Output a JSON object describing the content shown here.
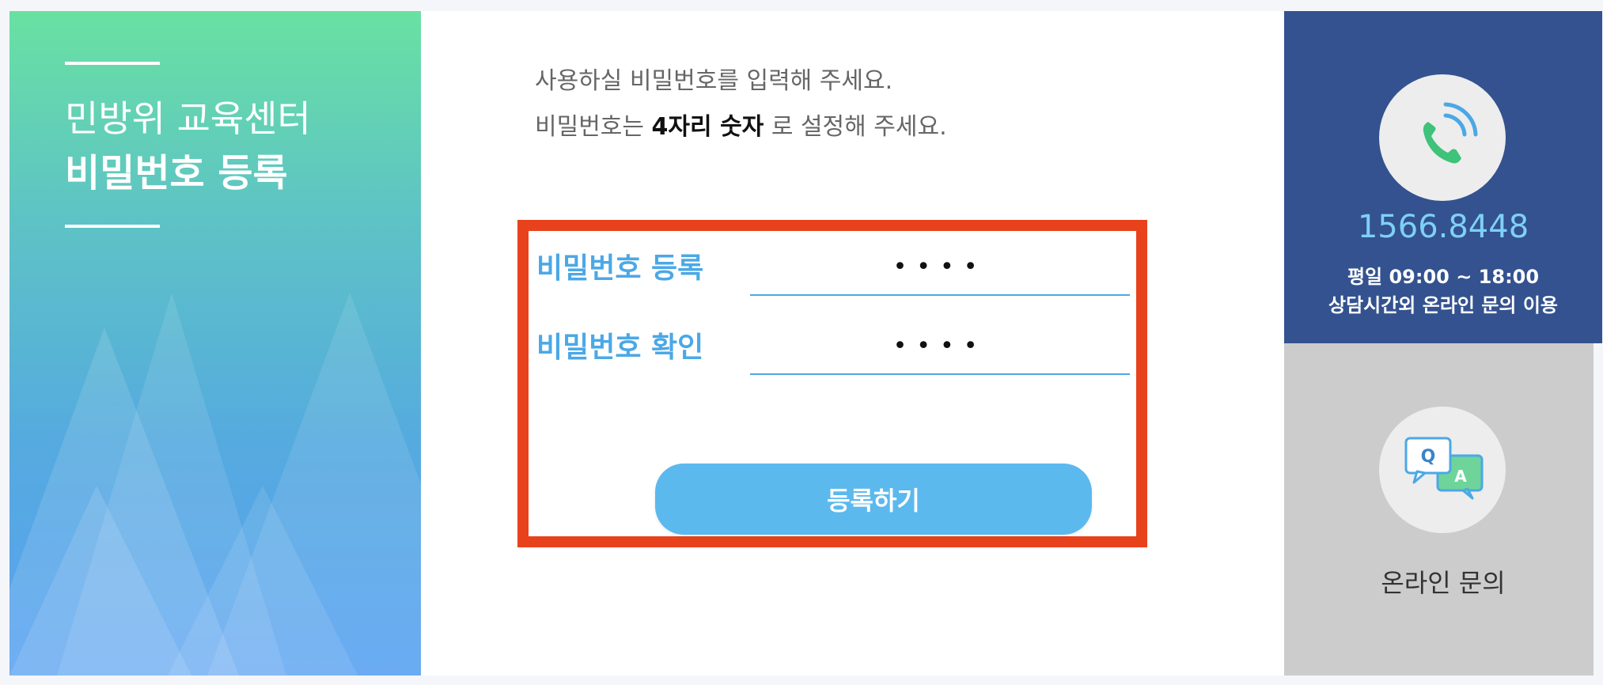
{
  "left_panel": {
    "subtitle": "민방위 교육센터",
    "title": "비밀번호 등록"
  },
  "instructions": {
    "line1": "사용하실 비밀번호를 입력해 주세요.",
    "line2_prefix": "비밀번호는",
    "line2_highlight": "4자리 숫자",
    "line2_suffix": "로 설정해 주세요."
  },
  "form": {
    "password_label": "비밀번호 등록",
    "password_value": "••••",
    "confirm_label": "비밀번호 확인",
    "confirm_value": "••••",
    "submit_label": "등록하기"
  },
  "contact": {
    "phone_icon": "phone-icon",
    "phone": "1566.8448",
    "hours_line1": "평일 09:00 ~ 18:00",
    "hours_line2": "상담시간외 온라인 문의 이용",
    "qa_icon": "qa-chat-icon",
    "online_label": "온라인 문의"
  },
  "colors": {
    "accent_blue": "#4ba8e6",
    "button_blue": "#5bb9ee",
    "highlight_red": "#e8421d",
    "panel_navy": "#33528f",
    "phone_text": "#7fd0f6"
  }
}
